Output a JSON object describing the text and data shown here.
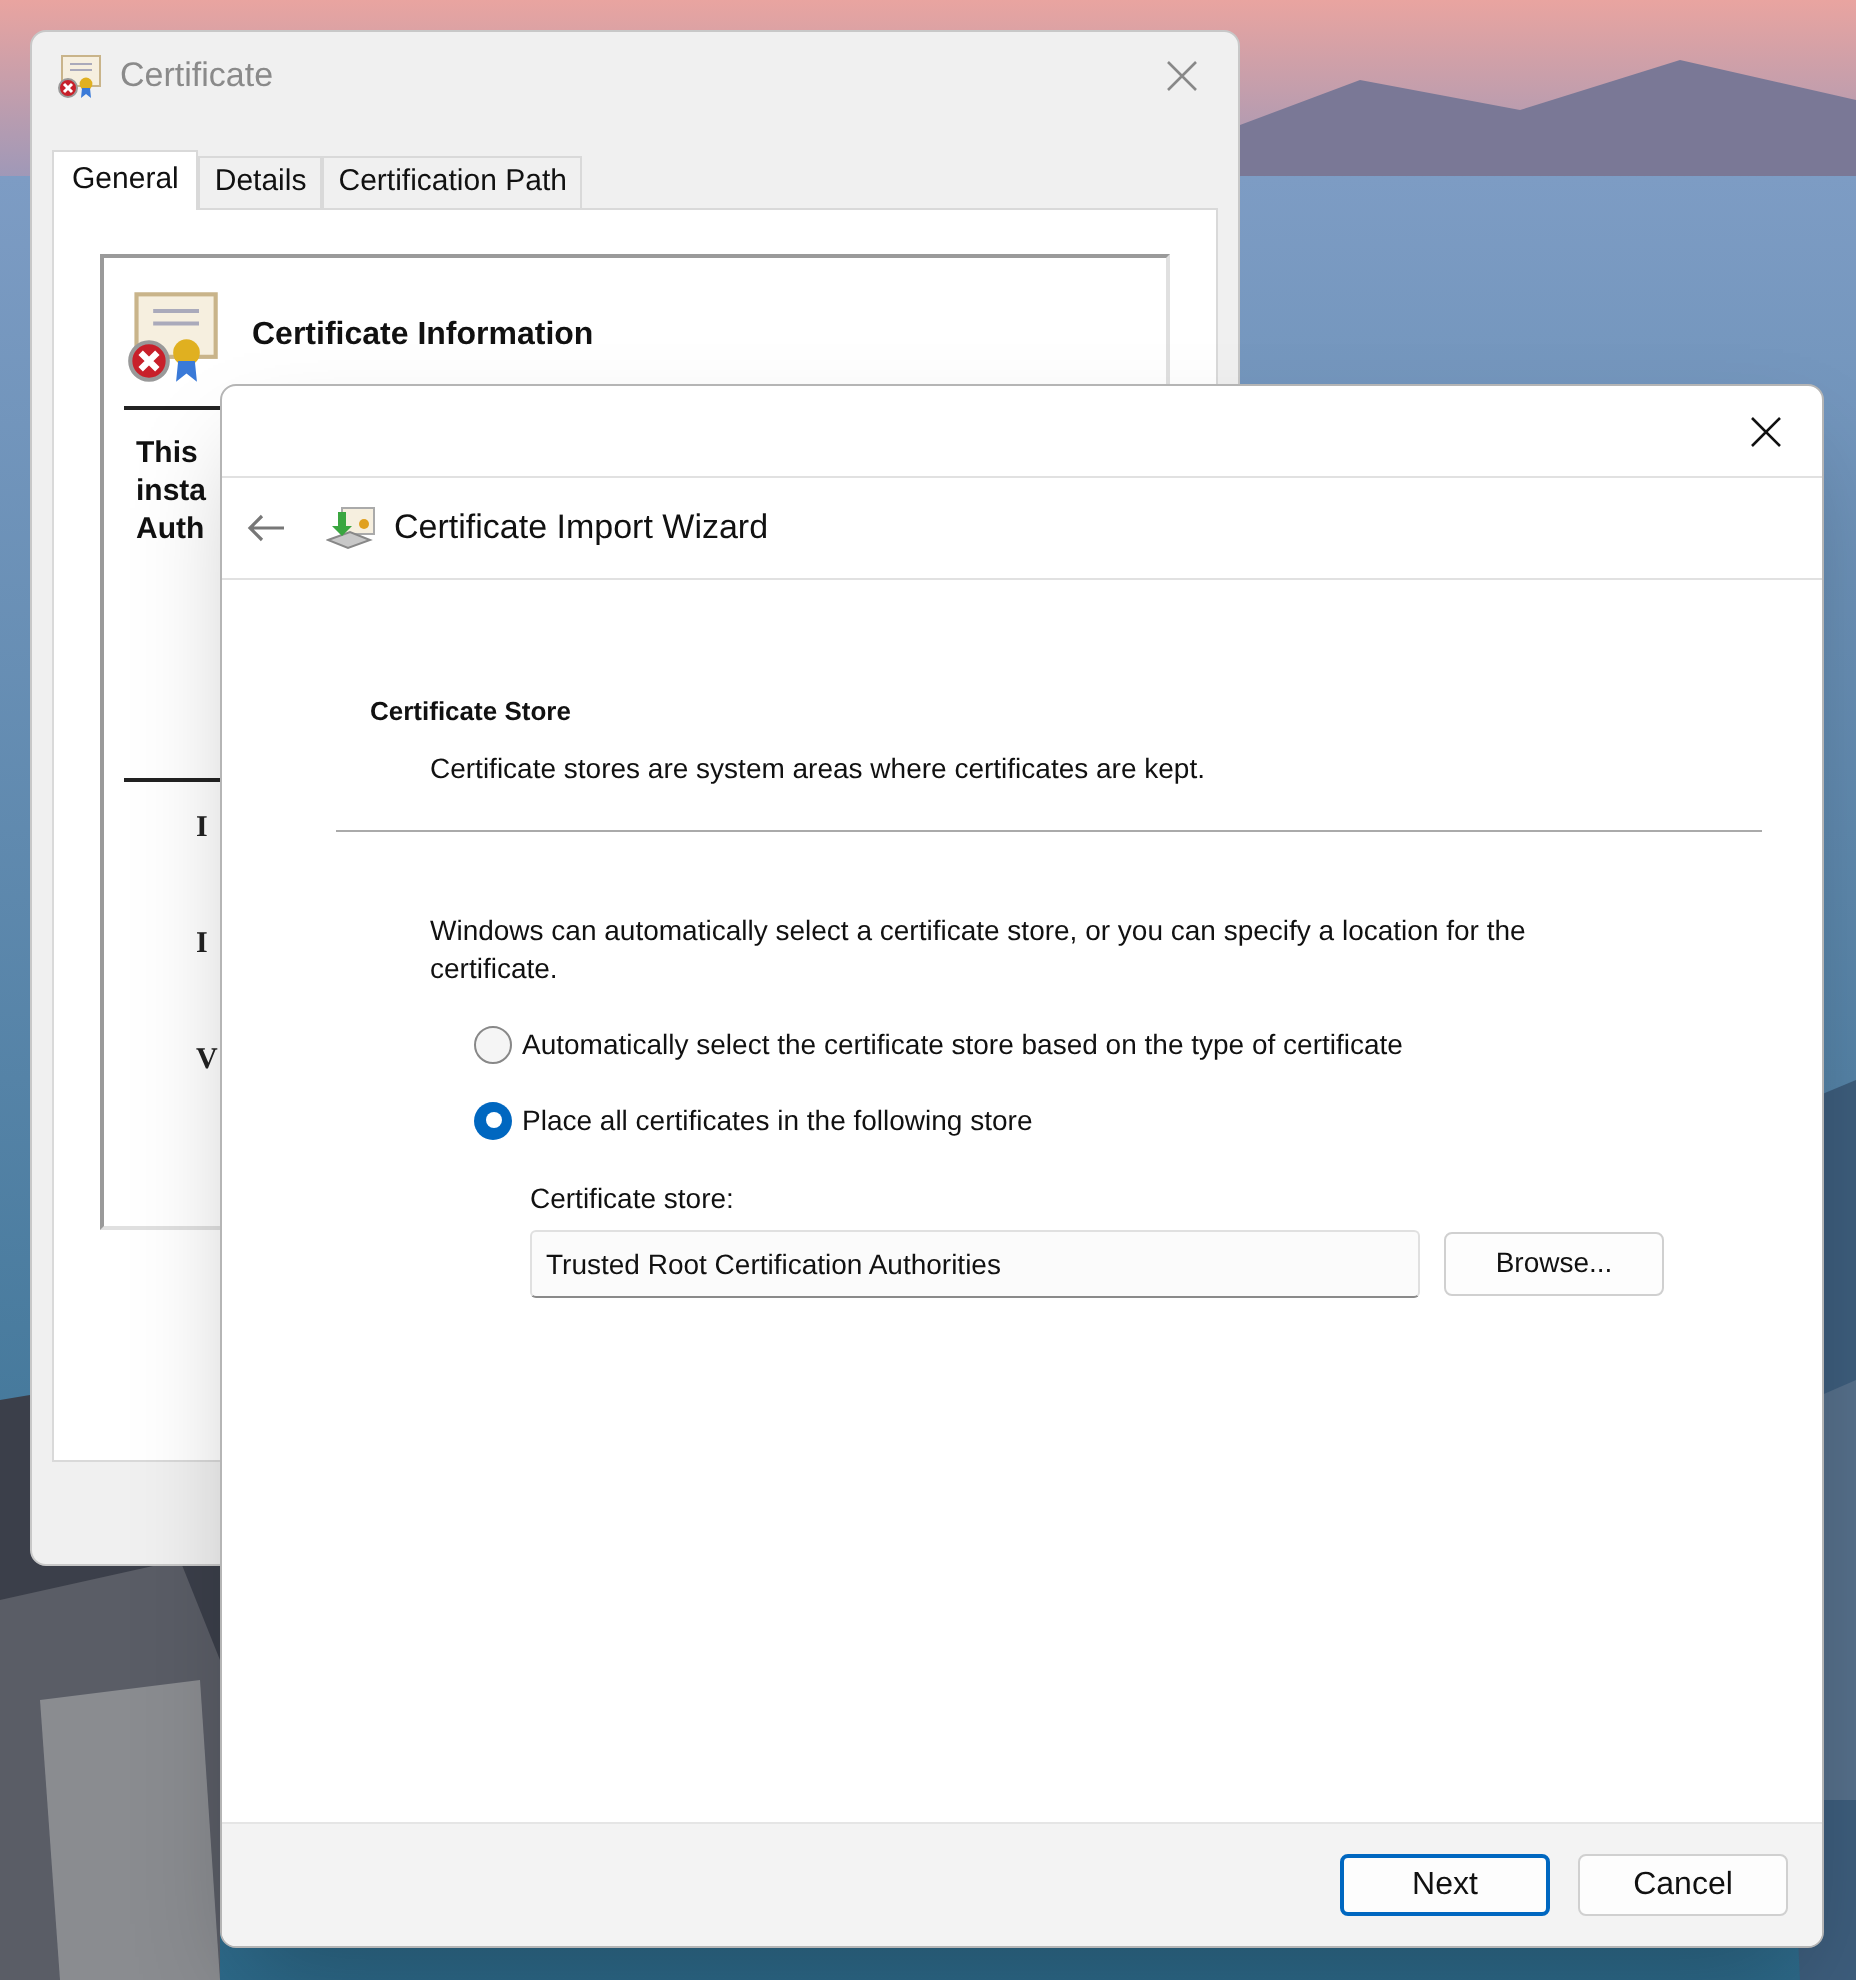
{
  "certificate_window": {
    "title": "Certificate",
    "tabs": [
      {
        "label": "General",
        "selected": true
      },
      {
        "label": "Details",
        "selected": false
      },
      {
        "label": "Certification Path",
        "selected": false
      }
    ],
    "info_title": "Certificate Information",
    "info_lines": [
      "This",
      "insta",
      "Auth"
    ],
    "field_marks": [
      "I",
      "I",
      "V"
    ]
  },
  "wizard": {
    "title": "Certificate Import Wizard",
    "section_title": "Certificate Store",
    "section_description": "Certificate stores are system areas where certificates are kept.",
    "instructions": "Windows can automatically select a certificate store, or you can specify a location for the certificate.",
    "options": [
      {
        "label": "Automatically select the certificate store based on the type of certificate",
        "selected": false
      },
      {
        "label": "Place all certificates in the following store",
        "selected": true
      }
    ],
    "store_label": "Certificate store:",
    "store_value": "Trusted Root Certification Authorities",
    "browse_button": "Browse...",
    "buttons": [
      {
        "label": "Next",
        "default": true
      },
      {
        "label": "Cancel",
        "default": false
      }
    ]
  }
}
